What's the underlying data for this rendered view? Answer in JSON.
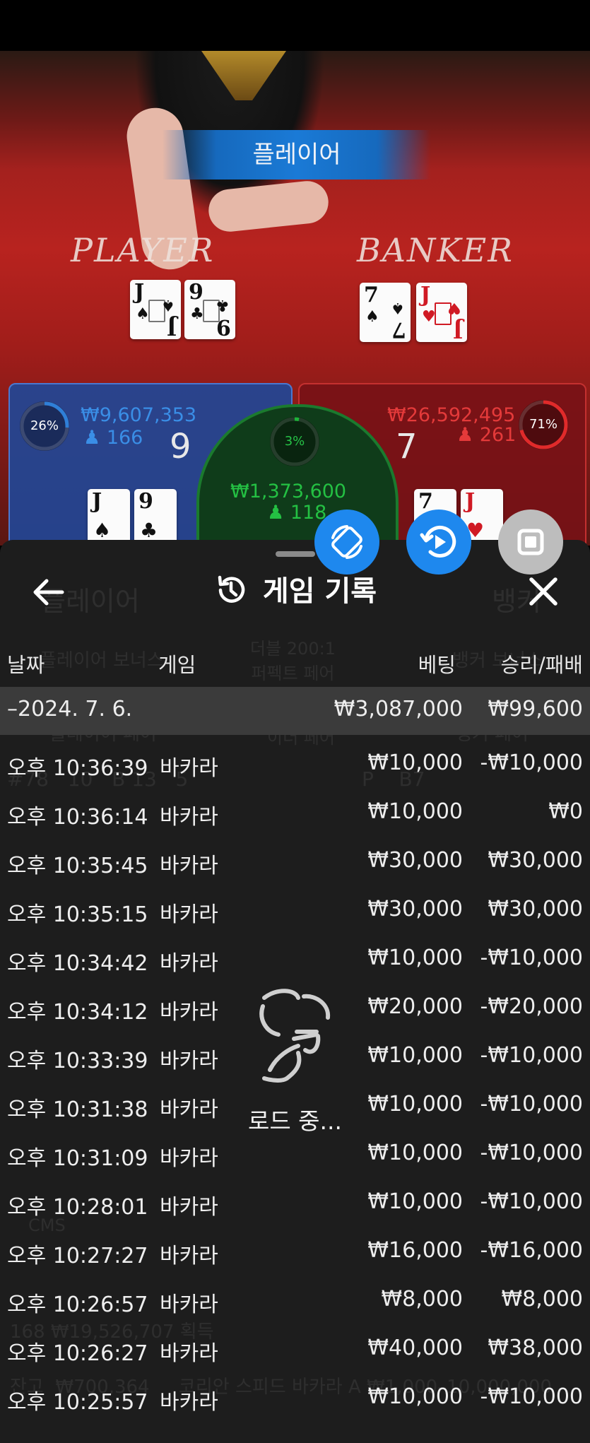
{
  "video": {
    "banner": "플레이어",
    "player_word": "PLAYER",
    "banker_word": "BANKER",
    "player_cards": [
      {
        "rank": "J",
        "suit": "♠",
        "color": "black"
      },
      {
        "rank": "9",
        "suit": "♣",
        "color": "black"
      }
    ],
    "banker_cards": [
      {
        "rank": "7",
        "suit": "♠",
        "color": "black"
      },
      {
        "rank": "J",
        "suit": "♥",
        "color": "red"
      }
    ]
  },
  "bets": {
    "player": {
      "pct": "26%",
      "pct_value": 26,
      "amount": "₩9,607,353",
      "count": "166",
      "score": "9",
      "color": "#2f7fd8"
    },
    "tie": {
      "pct": "3%",
      "pct_value": 3,
      "amount": "₩1,373,600",
      "count": "118",
      "color": "#1eb43a"
    },
    "banker": {
      "pct": "71%",
      "pct_value": 71,
      "amount": "₩26,592,495",
      "count": "261",
      "score": "7",
      "color": "#e02a2a"
    },
    "mini_cards_player": [
      {
        "rank": "J",
        "suit": "♠",
        "color": "black"
      },
      {
        "rank": "9",
        "suit": "♣",
        "color": "black"
      }
    ],
    "mini_cards_banker": [
      {
        "rank": "7",
        "suit": "",
        "color": "black"
      },
      {
        "rank": "J",
        "suit": "♥",
        "color": "red"
      }
    ]
  },
  "colors": {
    "accent": "#1e88ee",
    "panel": "#1d1d1d",
    "row_highlight": "#3b3b3b",
    "fab_gray": "#bdbdbd"
  },
  "icons": {
    "fab1": "rotate-device-icon",
    "fab2": "replay-video-icon",
    "fab3": "stop-icon",
    "back": "back-arrow-icon",
    "history": "history-icon",
    "close": "close-icon",
    "loader": "loading-spinner-icon"
  },
  "history": {
    "title": "게임 기록",
    "columns": {
      "date": "날짜",
      "game": "게임",
      "bet": "베팅",
      "result": "승리/패배"
    },
    "day": {
      "date": "–2024. 7. 6.",
      "bet": "₩3,087,000",
      "result": "₩99,600"
    },
    "rows": [
      {
        "time": "오후 10:36:39",
        "game": "바카라",
        "bet": "₩10,000",
        "result": "-₩10,000"
      },
      {
        "time": "오후 10:36:14",
        "game": "바카라",
        "bet": "₩10,000",
        "result": "₩0"
      },
      {
        "time": "오후 10:35:45",
        "game": "바카라",
        "bet": "₩30,000",
        "result": "₩30,000"
      },
      {
        "time": "오후 10:35:15",
        "game": "바카라",
        "bet": "₩30,000",
        "result": "₩30,000"
      },
      {
        "time": "오후 10:34:42",
        "game": "바카라",
        "bet": "₩10,000",
        "result": "-₩10,000"
      },
      {
        "time": "오후 10:34:12",
        "game": "바카라",
        "bet": "₩20,000",
        "result": "-₩20,000"
      },
      {
        "time": "오후 10:33:39",
        "game": "바카라",
        "bet": "₩10,000",
        "result": "-₩10,000"
      },
      {
        "time": "오후 10:31:38",
        "game": "바카라",
        "bet": "₩10,000",
        "result": "-₩10,000"
      },
      {
        "time": "오후 10:31:09",
        "game": "바카라",
        "bet": "₩10,000",
        "result": "-₩10,000"
      },
      {
        "time": "오후 10:28:01",
        "game": "바카라",
        "bet": "₩10,000",
        "result": "-₩10,000"
      },
      {
        "time": "오후 10:27:27",
        "game": "바카라",
        "bet": "₩16,000",
        "result": "-₩16,000"
      },
      {
        "time": "오후 10:26:57",
        "game": "바카라",
        "bet": "₩8,000",
        "result": "₩8,000"
      },
      {
        "time": "오후 10:26:27",
        "game": "바카라",
        "bet": "₩40,000",
        "result": "₩38,000"
      },
      {
        "time": "오후 10:25:57",
        "game": "바카라",
        "bet": "₩10,000",
        "result": "-₩10,000"
      }
    ],
    "loading": "로드 중..."
  },
  "background_ghost": {
    "tab_player": "플레이어",
    "tab_banker": "뱅커",
    "player_bonus": "플레이어 보너스",
    "perfect_pair": "더블 200:1\n퍼펙트 페어",
    "banker_bonus": "뱅커 보너스",
    "player_pair": "플레이어 페어",
    "either_pair": "5:1\n이더 페어",
    "banker_pair": "뱅커 페어",
    "stats_left": "#78   10   B 13   5",
    "stats_right": "P    B7",
    "balance": "168  ₩19,526,707 획득",
    "footer": "잔고  ₩700,364     코리안 스피드 바카라 A ₩1,000–10,000,000",
    "logo": "CMS"
  }
}
